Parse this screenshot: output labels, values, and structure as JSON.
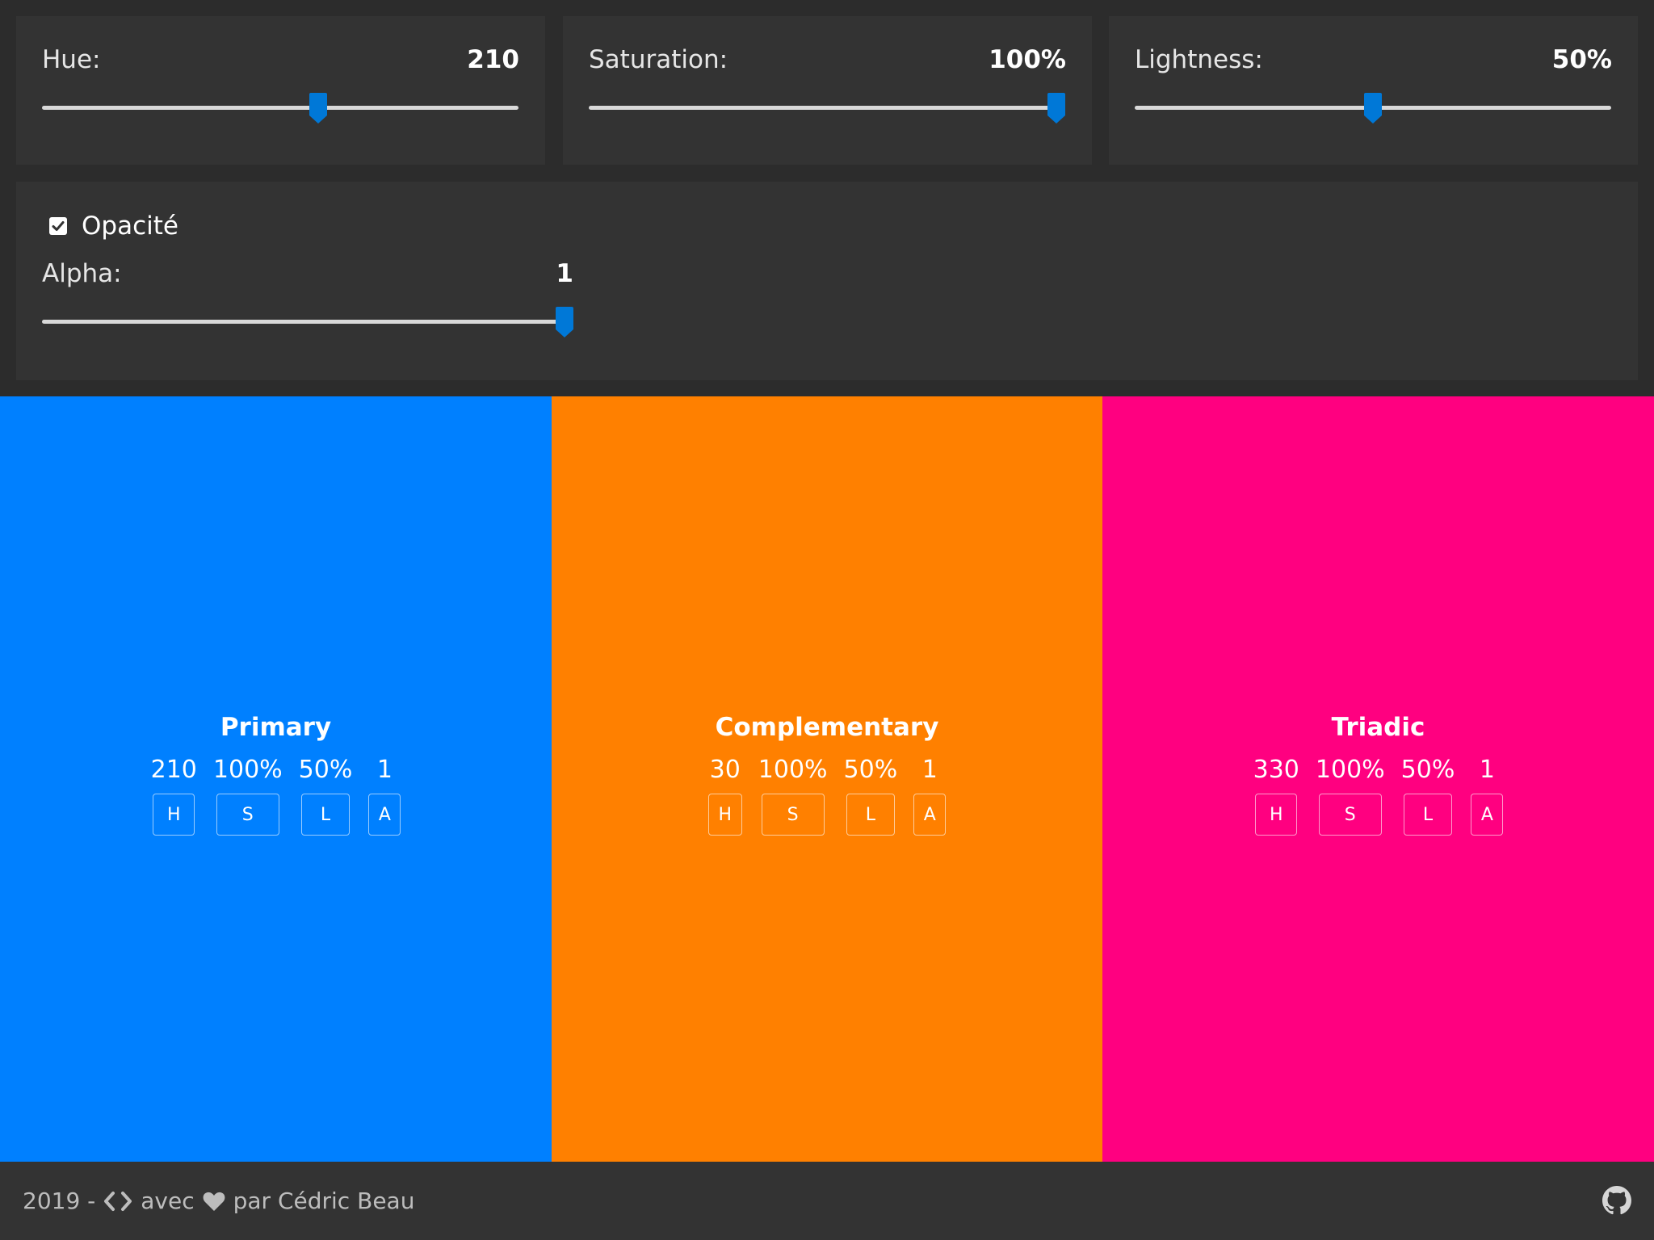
{
  "sliders": {
    "hue": {
      "label": "Hue:",
      "value": "210",
      "fraction": 0.583
    },
    "saturation": {
      "label": "Saturation:",
      "value": "100%",
      "fraction": 1.0
    },
    "lightness": {
      "label": "Lightness:",
      "value": "50%",
      "fraction": 0.5
    },
    "alpha": {
      "label": "Alpha:",
      "value": "1",
      "fraction": 1.0
    }
  },
  "opacity": {
    "label": "Opacité",
    "checked": true
  },
  "panels": [
    {
      "title": "Primary",
      "h": "210",
      "s": "100%",
      "l": "50%",
      "a": "1",
      "color": "#0080ff"
    },
    {
      "title": "Complementary",
      "h": "30",
      "s": "100%",
      "l": "50%",
      "a": "1",
      "color": "#ff8000"
    },
    {
      "title": "Triadic",
      "h": "330",
      "s": "100%",
      "l": "50%",
      "a": "1",
      "color": "#ff0080"
    }
  ],
  "buttons": {
    "h": "H",
    "s": "S",
    "l": "L",
    "a": "A"
  },
  "footer": {
    "year": "2019 -",
    "avec": "avec",
    "author": "par Cédric Beau"
  },
  "colors": {
    "accent": "#0078d7",
    "background": "#2c2c2c",
    "card": "#333333"
  },
  "icons": {
    "code": "code-icon",
    "heart": "heart-icon",
    "github": "github-icon",
    "checkbox": "checkbox-checked-icon"
  }
}
